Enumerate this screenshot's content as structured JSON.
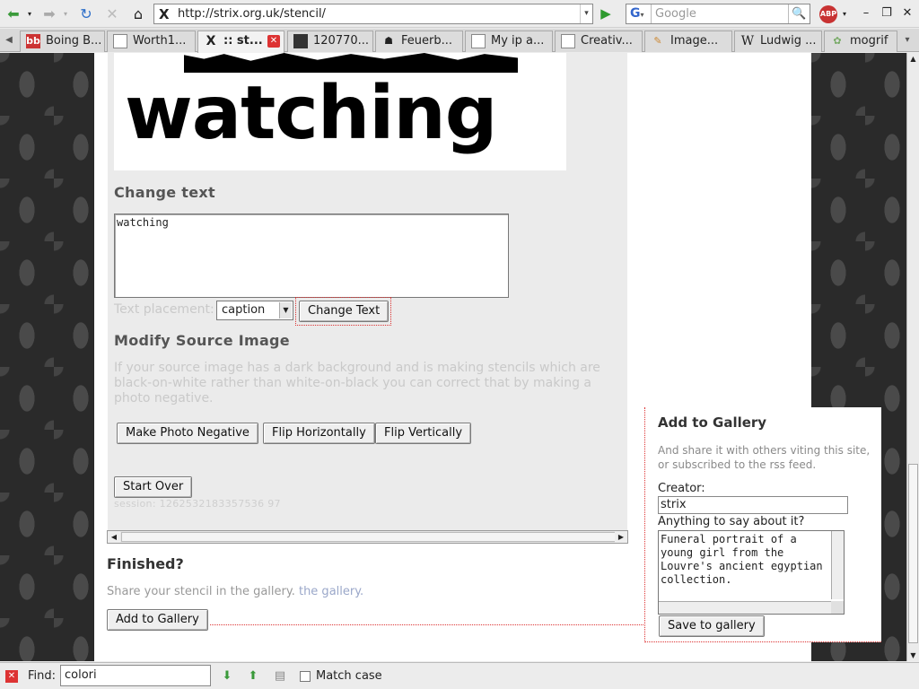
{
  "browser": {
    "url": "http://strix.org.uk/stencil/",
    "search_placeholder": "Google",
    "abp": "ABP",
    "tabs": [
      {
        "label": "Boing B...",
        "icon": "bb"
      },
      {
        "label": "Worth1...",
        "icon": ""
      },
      {
        "label": ":: st...",
        "icon": "X",
        "active": true
      },
      {
        "label": "120770...",
        "icon": ""
      },
      {
        "label": "Feuerb...",
        "icon": ""
      },
      {
        "label": "My ip a...",
        "icon": ""
      },
      {
        "label": "Creativ...",
        "icon": ""
      },
      {
        "label": "Image...",
        "icon": ""
      },
      {
        "label": "Ludwig ...",
        "icon": "W"
      },
      {
        "label": "mogrif",
        "icon": ""
      }
    ]
  },
  "stencil": {
    "word": "watching"
  },
  "editor": {
    "change_text_title": "Change text",
    "text_value": "watching",
    "placement_label": "Text placement:",
    "placement_value": "caption",
    "change_text_button": "Change Text",
    "modify_title": "Modify Source Image",
    "modify_help": "If your source image has a dark background and is making stencils which are black-on-white rather than white-on-black you can correct that by making a photo negative.",
    "negative_button": "Make Photo Negative",
    "flip_h_button": "Flip Horizontally",
    "flip_v_button": "Flip Vertically",
    "start_over_button": "Start Over",
    "session": "session: 1262532183357536 97"
  },
  "finished": {
    "title": "Finished?",
    "text": "Share your stencil in the gallery.",
    "link": "the gallery.",
    "add_button": "Add to Gallery"
  },
  "gallery": {
    "title": "Add to Gallery",
    "help": "And share it with others viting this site, or subscribed to the rss feed.",
    "creator_label": "Creator:",
    "creator_value": "strix",
    "comment_label": "Anything to say about it?",
    "comment_value": "Funeral portrait of a young girl from the Louvre's ancient egyptian collection.",
    "save_button": "Save to gallery"
  },
  "findbar": {
    "label": "Find:",
    "value": "colori",
    "match_case": "Match case"
  }
}
